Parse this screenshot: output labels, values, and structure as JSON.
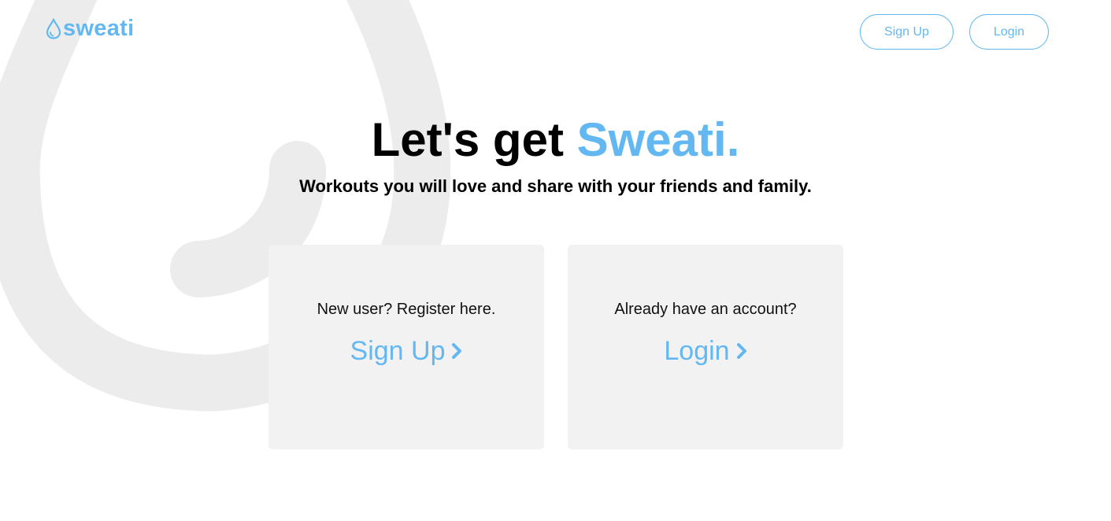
{
  "brand": {
    "name": "sweati",
    "accent_color": "#63b8f2",
    "background_graphic": "water-drop-outline"
  },
  "nav": {
    "signup_label": "Sign Up",
    "login_label": "Login"
  },
  "hero": {
    "title_prefix": "Let's get ",
    "title_accent": "Sweati.",
    "subtitle": "Workouts you will love and share with your friends and family."
  },
  "cards": {
    "signup": {
      "prompt": "New user? Register here.",
      "link_label": "Sign Up",
      "icon": "chevron-right-icon"
    },
    "login": {
      "prompt": "Already have an account?",
      "link_label": "Login",
      "icon": "chevron-right-icon"
    }
  }
}
